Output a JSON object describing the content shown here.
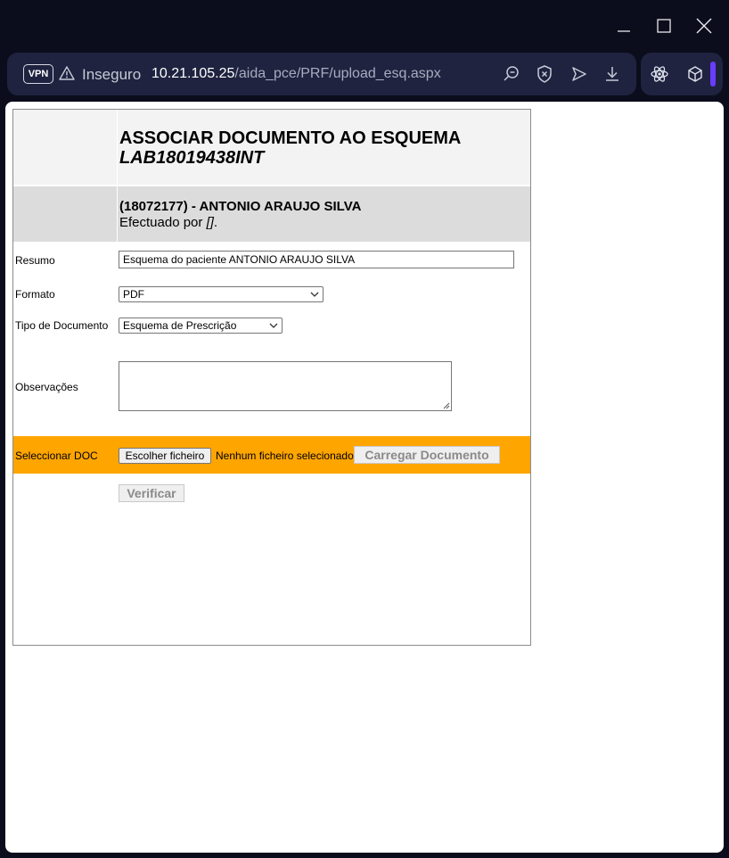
{
  "browser": {
    "vpn_label": "VPN",
    "security_label": "Inseguro",
    "url_host": "10.21.105.25",
    "url_path": "/aida_pce/PRF/upload_esq.aspx",
    "accent_color": "#6a3cff"
  },
  "page": {
    "title_line1": "ASSOCIAR DOCUMENTO AO ESQUEMA",
    "title_line2": "LAB18019438INT",
    "patient": "(18072177) - ANTONIO ARAUJO SILVA",
    "performed_by_prefix": "Efectuado por ",
    "performed_by_value": "[]",
    "performed_by_suffix": "."
  },
  "form": {
    "resumo_label": "Resumo",
    "resumo_value": "Esquema do paciente ANTONIO ARAUJO SILVA",
    "formato_label": "Formato",
    "formato_value": "PDF",
    "tipo_label": "Tipo de Documento",
    "tipo_value": "Esquema de Prescrição",
    "observacoes_label": "Observações",
    "observacoes_value": "",
    "seleccionar_label": "Seleccionar DOC",
    "choose_file_label": "Escolher ficheiro",
    "no_file_label": "Nenhum ficheiro selecionado",
    "upload_label": "Carregar Documento",
    "verify_label": "Verificar",
    "highlight_color": "#ffa500"
  }
}
